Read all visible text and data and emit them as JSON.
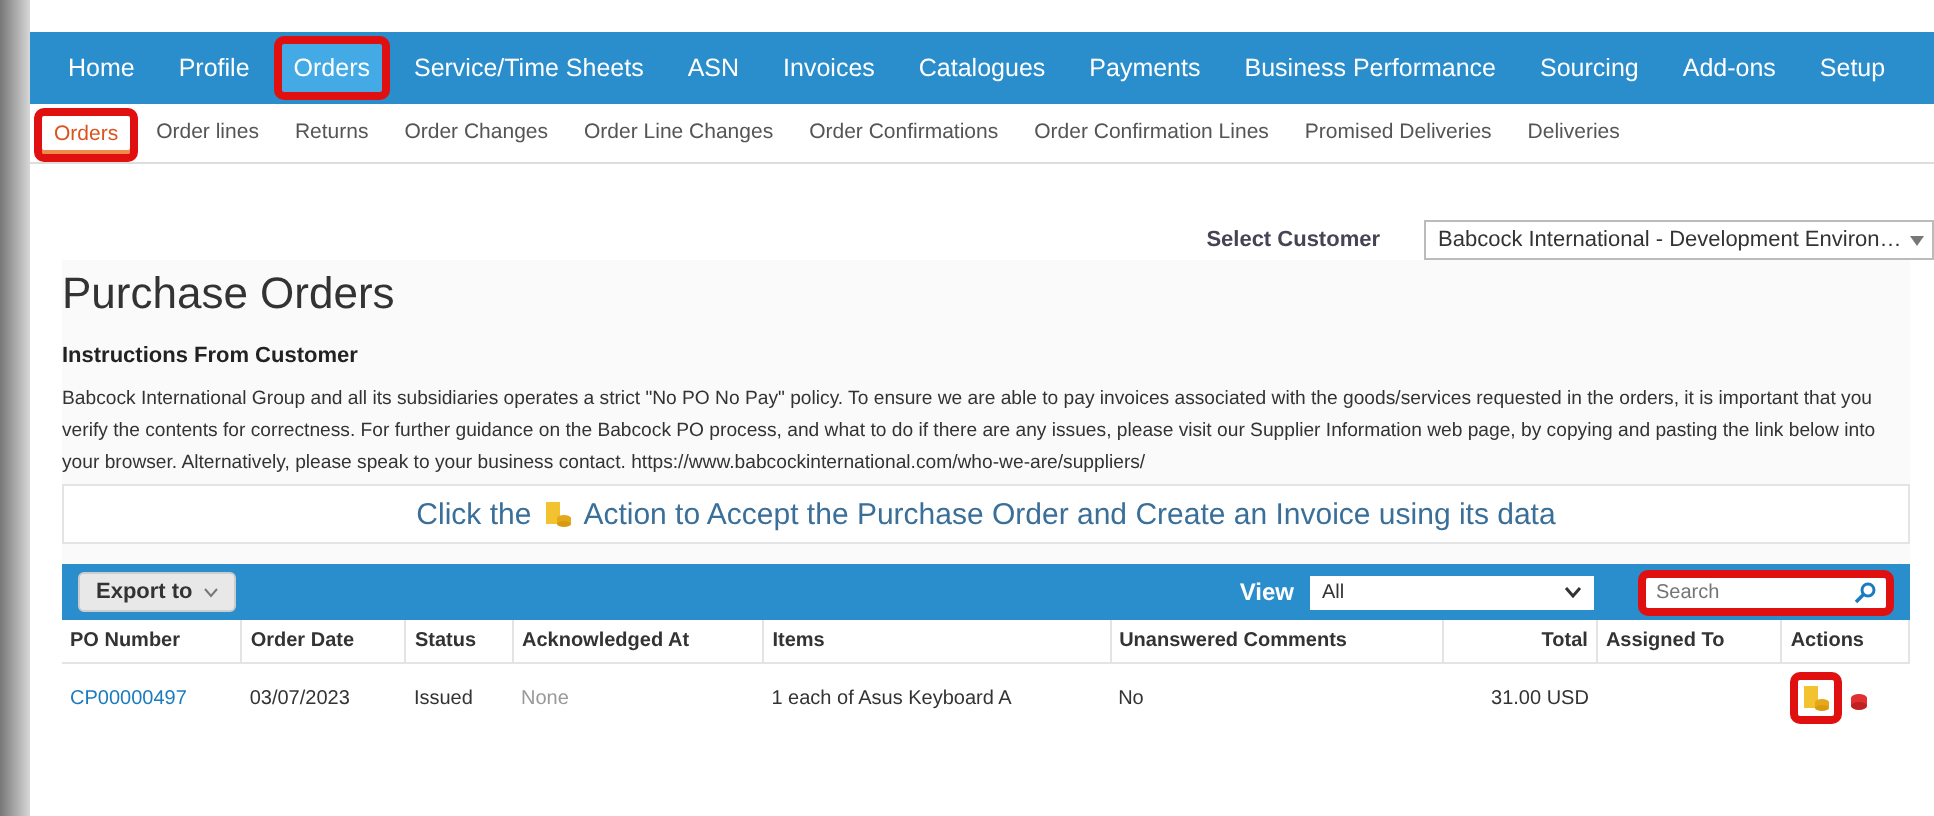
{
  "nav": [
    {
      "label": "Home",
      "selected": false,
      "highlighted": false
    },
    {
      "label": "Profile",
      "selected": false,
      "highlighted": false
    },
    {
      "label": "Orders",
      "selected": true,
      "highlighted": true
    },
    {
      "label": "Service/Time Sheets",
      "selected": false,
      "highlighted": false
    },
    {
      "label": "ASN",
      "selected": false,
      "highlighted": false
    },
    {
      "label": "Invoices",
      "selected": false,
      "highlighted": false
    },
    {
      "label": "Catalogues",
      "selected": false,
      "highlighted": false
    },
    {
      "label": "Payments",
      "selected": false,
      "highlighted": false
    },
    {
      "label": "Business Performance",
      "selected": false,
      "highlighted": false
    },
    {
      "label": "Sourcing",
      "selected": false,
      "highlighted": false
    },
    {
      "label": "Add-ons",
      "selected": false,
      "highlighted": false
    },
    {
      "label": "Setup",
      "selected": false,
      "highlighted": false
    }
  ],
  "subtabs": [
    {
      "label": "Orders",
      "selected": true,
      "highlighted": true
    },
    {
      "label": "Order lines",
      "selected": false,
      "highlighted": false
    },
    {
      "label": "Returns",
      "selected": false,
      "highlighted": false
    },
    {
      "label": "Order Changes",
      "selected": false,
      "highlighted": false
    },
    {
      "label": "Order Line Changes",
      "selected": false,
      "highlighted": false
    },
    {
      "label": "Order Confirmations",
      "selected": false,
      "highlighted": false
    },
    {
      "label": "Order Confirmation Lines",
      "selected": false,
      "highlighted": false
    },
    {
      "label": "Promised Deliveries",
      "selected": false,
      "highlighted": false
    },
    {
      "label": "Deliveries",
      "selected": false,
      "highlighted": false
    }
  ],
  "customer": {
    "label": "Select Customer",
    "value": "Babcock International - Development Environ…"
  },
  "title": "Purchase Orders",
  "instructions": {
    "heading": "Instructions From Customer",
    "text": "Babcock International Group and all its subsidiaries operates a strict \"No PO No Pay\" policy. To ensure we are able to pay invoices associated with the goods/services requested in the orders, it is important that you verify the contents for correctness. For further guidance on the Babcock PO process, and what to do if there are any issues, please visit our Supplier Information web page, by copying and pasting the link below into your browser. Alternatively, please speak to your business contact. https://www.babcockinternational.com/who-we-are/suppliers/"
  },
  "banner": {
    "before": "Click the",
    "after": "Action to Accept the Purchase Order and Create an Invoice using its data"
  },
  "toolbar": {
    "export": "Export to",
    "view_label": "View",
    "view_value": "All",
    "search_placeholder": "Search",
    "search_highlighted": true
  },
  "table": {
    "columns": [
      "PO Number",
      "Order Date",
      "Status",
      "Acknowledged At",
      "Items",
      "Unanswered Comments",
      "Total",
      "Assigned To",
      "Actions"
    ],
    "rows": [
      {
        "po": "CP00000497",
        "date": "03/07/2023",
        "status": "Issued",
        "acknowledged": "None",
        "items": "1 each of Asus Keyboard A",
        "comments": "No",
        "total": "31.00 USD",
        "assigned": "",
        "action_highlighted": true
      }
    ]
  }
}
